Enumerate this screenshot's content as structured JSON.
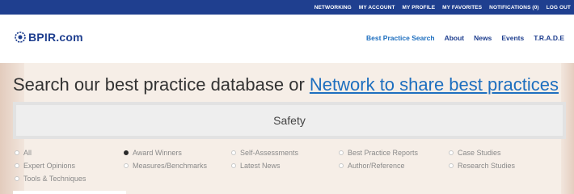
{
  "topbar": {
    "links": [
      "NETWORKING",
      "MY ACCOUNT",
      "MY PROFILE",
      "MY FAVORITES",
      "NOTIFICATIONS (0)",
      "LOG OUT"
    ]
  },
  "logo": {
    "text": "BPIR.com",
    "icon": "bpir-logo-icon"
  },
  "nav": {
    "items": [
      "Best Practice Search",
      "About",
      "News",
      "Events",
      "T.R.A.D.E"
    ]
  },
  "headline": {
    "prefix": "Search our best practice database or ",
    "link": "Network to share best practices"
  },
  "search": {
    "value": "Safety"
  },
  "options": {
    "row1": [
      {
        "label": "All",
        "checked": false
      },
      {
        "label": "Award Winners",
        "checked": true
      },
      {
        "label": "Self-Assessments",
        "checked": false
      },
      {
        "label": "Best Practice Reports",
        "checked": false
      },
      {
        "label": "Case Studies",
        "checked": false
      }
    ],
    "row2": [
      {
        "label": "Expert Opinions",
        "checked": false
      },
      {
        "label": "Measures/Benchmarks",
        "checked": false
      },
      {
        "label": "Latest News",
        "checked": false
      },
      {
        "label": "Author/Reference",
        "checked": false
      },
      {
        "label": "Research Studies",
        "checked": false
      }
    ],
    "row3": [
      {
        "label": "Tools & Techniques",
        "checked": false
      }
    ]
  },
  "colors": {
    "brand": "#1f3f8f",
    "link": "#1e6fbf",
    "background": "#f6eee7"
  }
}
